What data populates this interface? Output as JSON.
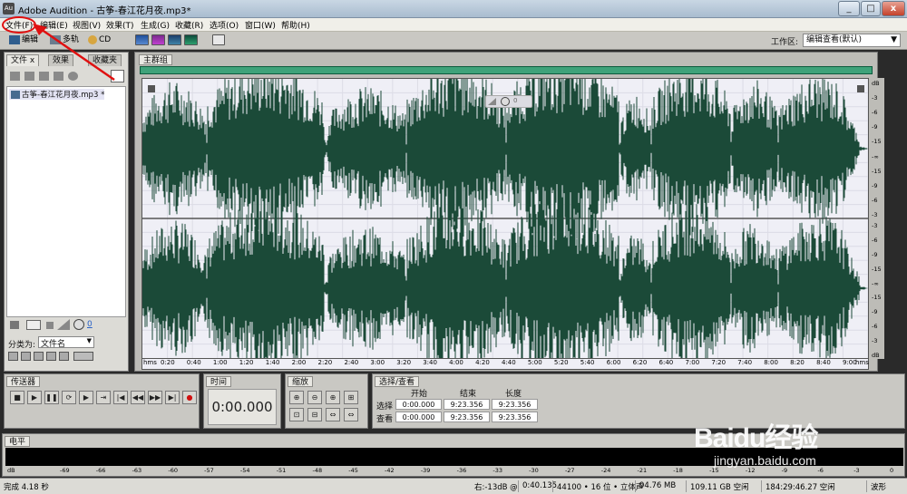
{
  "window": {
    "app_icon": "Au",
    "title": "Adobe Audition - 古筝-春江花月夜.mp3*",
    "min": "_",
    "max": "□",
    "close": "x"
  },
  "menu": [
    "文件(F)",
    "编辑(E)",
    "视图(V)",
    "效果(T)",
    "生成(G)",
    "收藏(R)",
    "选项(O)",
    "窗口(W)",
    "帮助(H)"
  ],
  "toolbar": {
    "edit_label": "编辑",
    "multitrack_label": "多轨",
    "cd_label": "CD",
    "workspace_label": "工作区:",
    "workspace_value": "编辑查看(默认)"
  },
  "left_panel": {
    "tabs": [
      "文件",
      "效果",
      "收藏夹"
    ],
    "tab_close": "x",
    "file_item": "古筝-春江花月夜.mp3",
    "file_marker": "*",
    "volume_value": "0",
    "sort_label": "分类为:",
    "sort_value": "文件名"
  },
  "main_panel": {
    "tab": "主群组",
    "tab_close": "x",
    "volume_value": "0"
  },
  "ruler": {
    "labels": [
      "hms",
      "0:20",
      "0:40",
      "1:00",
      "1:20",
      "1:40",
      "2:00",
      "2:20",
      "2:40",
      "3:00",
      "3:20",
      "3:40",
      "4:00",
      "4:20",
      "4:40",
      "5:00",
      "5:20",
      "5:40",
      "6:00",
      "6:20",
      "6:40",
      "7:00",
      "7:20",
      "7:40",
      "8:00",
      "8:20",
      "8:40",
      "9:00",
      "hms"
    ]
  },
  "db_scale": {
    "top_channel": [
      "dB",
      "-3",
      "-6",
      "-9",
      "-15",
      "-∞",
      "-15",
      "-9",
      "-6",
      "-3"
    ],
    "bottom_channel": [
      "-3",
      "-6",
      "-9",
      "-15",
      "-∞",
      "-15",
      "-9",
      "-6",
      "-3",
      "dB"
    ]
  },
  "transport": {
    "tab": "传送器",
    "buttons": [
      "■",
      "▶",
      "❚❚",
      "⟳",
      "▶",
      "⇥",
      "|◀",
      "◀◀",
      "▶▶",
      "▶|",
      "●"
    ]
  },
  "time_panel": {
    "tab": "时间",
    "value": "0:00.000"
  },
  "zoom_panel": {
    "tab": "缩放",
    "buttons": [
      "⊕",
      "⊖",
      "⊕",
      "⊞",
      "⊡",
      "⊟",
      "⇔",
      "⇔"
    ]
  },
  "selection_panel": {
    "tab": "选择/查看",
    "headers": [
      "开始",
      "结束",
      "长度"
    ],
    "rows": [
      {
        "label": "选择",
        "start": "0:00.000",
        "end": "9:23.356",
        "length": "9:23.356"
      },
      {
        "label": "查看",
        "start": "0:00.000",
        "end": "9:23.356",
        "length": "9:23.356"
      }
    ]
  },
  "level_panel": {
    "tab": "电平",
    "labels": [
      "dB",
      "-69",
      "-66",
      "-63",
      "-60",
      "-57",
      "-54",
      "-51",
      "-48",
      "-45",
      "-42",
      "-39",
      "-36",
      "-33",
      "-30",
      "-27",
      "-24",
      "-21",
      "-18",
      "-15",
      "-12",
      "-9",
      "-6",
      "-3",
      "0"
    ]
  },
  "status": {
    "completed": "完成 4.18 秒",
    "right_level": "右:-13dB @",
    "position": "0:40.135",
    "format": "44100 • 16 位 • 立体声",
    "size": "94.76 MB",
    "free_space": "109.11 GB 空闲",
    "free_time": "184:29:46.27 空闲",
    "view": "波形"
  },
  "watermark": {
    "logo": "Baidu经验",
    "url": "jingyan.baidu.com"
  },
  "colors": {
    "waveform": "#1b4a38",
    "highlight": "#e01010",
    "overview": "#3fa27a"
  }
}
